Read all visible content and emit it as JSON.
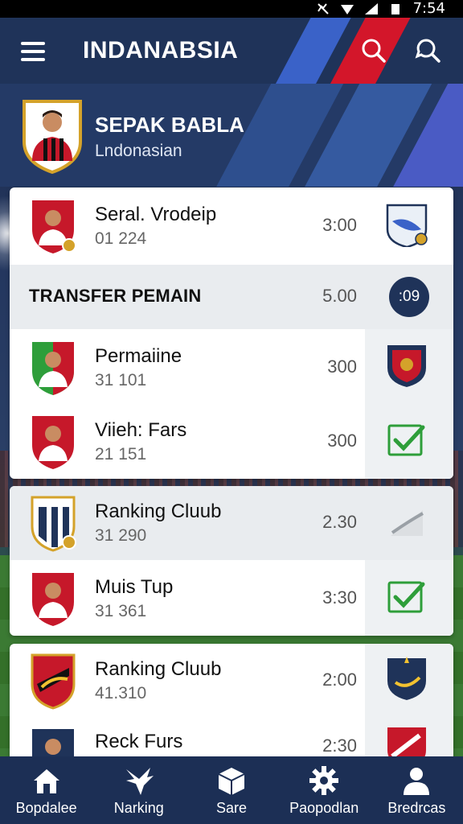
{
  "status_bar": {
    "time": "7:54"
  },
  "header": {
    "title": "INDANABSIA"
  },
  "profile": {
    "name": "SEPAK BABLA",
    "subtitle": "Lndonasian"
  },
  "card1": {
    "top_row": {
      "title": "Seral. Vrodeip",
      "sub": "01 224",
      "time": "3:00"
    },
    "section": {
      "title": "TRANSFER PEMAIN",
      "time": "5.00",
      "badge": ":09"
    },
    "rows": [
      {
        "title": "Permaiine",
        "sub": "31 101",
        "time": "300"
      },
      {
        "title": "Viieh: Fars",
        "sub": "21 151",
        "time": "300"
      }
    ]
  },
  "card2": {
    "rows": [
      {
        "title": "Ranking Cluub",
        "sub": "31 290",
        "time": "2.30"
      },
      {
        "title": "Muis Tup",
        "sub": "31 361",
        "time": "3:30"
      }
    ]
  },
  "card3": {
    "rows": [
      {
        "title": "Ranking Cluub",
        "sub": "41.310",
        "time": "2:00"
      },
      {
        "title": "Reck Furs",
        "sub": "",
        "time": "2:30"
      }
    ]
  },
  "bottom_nav": [
    {
      "label": "Bopdalee",
      "icon": "home-icon"
    },
    {
      "label": "Narking",
      "icon": "bird-icon"
    },
    {
      "label": "Sare",
      "icon": "box-icon"
    },
    {
      "label": "Paopodlan",
      "icon": "gear-icon"
    },
    {
      "label": "Bredrcas",
      "icon": "person-icon"
    }
  ],
  "colors": {
    "navy": "#1f3359",
    "red": "#d3162a",
    "blue": "#3a62c8",
    "check": "#2e9e3a"
  }
}
